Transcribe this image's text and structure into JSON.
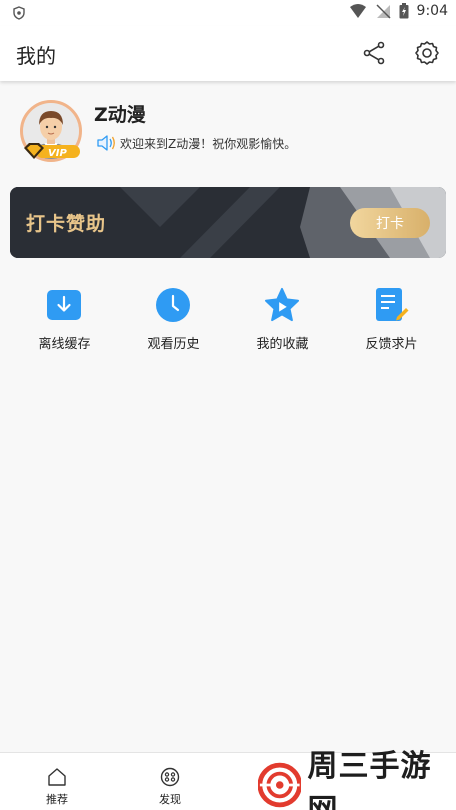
{
  "status_bar": {
    "time": "9:04"
  },
  "app_bar": {
    "title": "我的"
  },
  "profile": {
    "username": "Z动漫",
    "vip_badge": "VIP",
    "welcome": "欢迎来到Z动漫！祝你观影愉快。"
  },
  "banner": {
    "text": "打卡赞助",
    "button_label": "打卡"
  },
  "features": [
    {
      "label": "离线缓存",
      "icon": "download-icon",
      "color": "#2f9bf3"
    },
    {
      "label": "观看历史",
      "icon": "clock-icon",
      "color": "#2f9bf3"
    },
    {
      "label": "我的收藏",
      "icon": "star-icon",
      "color": "#2f9bf3"
    },
    {
      "label": "反馈求片",
      "icon": "feedback-icon",
      "color": "#2f9bf3"
    }
  ],
  "tab_bar": {
    "items": [
      {
        "label": "推荐",
        "icon": "home-icon"
      },
      {
        "label": "发现",
        "icon": "discover-icon"
      }
    ]
  },
  "watermark": {
    "text": "周三手游网"
  },
  "colors": {
    "accent": "#2f9bf3",
    "gold": "#e8c58a",
    "banner_dark": "#2b2f36"
  }
}
